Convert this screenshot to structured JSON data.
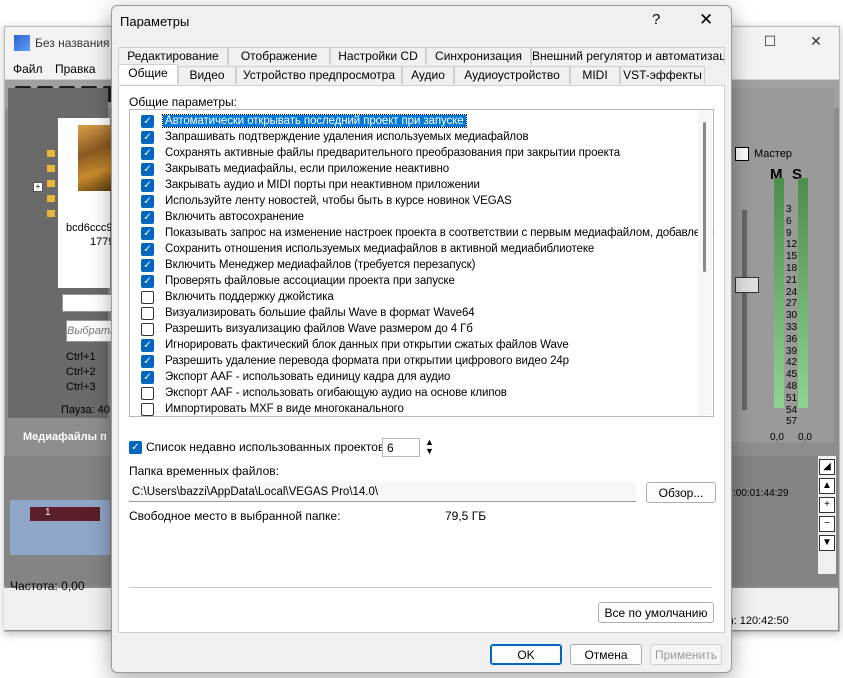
{
  "background_app": {
    "title": "Без названия",
    "menu": [
      "Файл",
      "Правка"
    ],
    "media_file": "bcd6ccc9",
    "media_file_size": "1779",
    "search_placeholder": "Выбрать",
    "shortcuts": [
      "Ctrl+1",
      "Ctrl+2",
      "Ctrl+3"
    ],
    "pause_label": "Пауза: 40",
    "media_panel_label": "Медиафайлы п",
    "master_label": "Мастер",
    "meter_marks": [
      "3",
      "6",
      "9",
      "12",
      "15",
      "18",
      "21",
      "24",
      "27",
      "30",
      "33",
      "36",
      "39",
      "42",
      "45",
      "48",
      "51",
      "54",
      "57"
    ],
    "meter_values": [
      "0,0",
      "0,0"
    ],
    "track_number": "1",
    "timecode": ":00:01:44:29",
    "frequency": "Частота: 0,00",
    "time_total": "): 120:42:50",
    "mixer_m": "M",
    "mixer_s": "S"
  },
  "dialog": {
    "title": "Параметры",
    "help": "?",
    "close": "✕",
    "tabs_row1": [
      "Редактирование",
      "Отображение",
      "Настройки CD",
      "Синхронизация",
      "Внешний регулятор и автоматизац"
    ],
    "tabs_row2": [
      "Общие",
      "Видео",
      "Устройство предпросмотра",
      "Аудио",
      "Аудиоустройство",
      "MIDI",
      "VST-эффекты"
    ],
    "active_tab": "Общие",
    "section_label": "Общие параметры:",
    "options": [
      {
        "label": "Автоматически открывать последний проект при запуске",
        "checked": true,
        "selected": true
      },
      {
        "label": "Запрашивать подтверждение удаления используемых медиафайлов",
        "checked": true
      },
      {
        "label": "Сохранять активные файлы предварительного преобразования при закрытии проекта",
        "checked": true
      },
      {
        "label": "Закрывать медиафайлы, если приложение неактивно",
        "checked": true
      },
      {
        "label": "Закрывать аудио и MIDI порты при неактивном приложении",
        "checked": true
      },
      {
        "label": "Используйте ленту новостей, чтобы быть в курсе новинок VEGAS",
        "checked": true
      },
      {
        "label": "Включить автосохранение",
        "checked": true
      },
      {
        "label": "Показывать запрос на изменение настроек проекта в соответствии с первым медиафайлом, добавленн",
        "checked": true
      },
      {
        "label": "Сохранить отношения используемых медиафайлов в активной медиабиблиотеке",
        "checked": true
      },
      {
        "label": "Включить Менеджер медиафайлов (требуется перезапуск)",
        "checked": true
      },
      {
        "label": "Проверять файловые ассоциации проекта при запуске",
        "checked": true
      },
      {
        "label": "Включить поддержку джойстика",
        "checked": false
      },
      {
        "label": "Визуализировать большие файлы Wave в формат Wave64",
        "checked": false
      },
      {
        "label": "Разрешить визуализацию файлов Wave размером до 4 Гб",
        "checked": false
      },
      {
        "label": "Игнорировать фактический блок данных при открытии сжатых файлов Wave",
        "checked": true
      },
      {
        "label": "Разрешить удаление перевода формата при открытии цифрового видео 24p",
        "checked": true
      },
      {
        "label": "Экспорт AAF - использовать единицу кадра для аудио",
        "checked": true
      },
      {
        "label": "Экспорт AAF - использовать огибающую аудио на основе клипов",
        "checked": false
      },
      {
        "label": "Импортировать MXF в виде многоканального",
        "checked": false
      }
    ],
    "recent_projects_label": "Список недавно использованных проектов:",
    "recent_projects_checked": true,
    "recent_projects_count": "6",
    "temp_folder_label": "Папка временных файлов:",
    "temp_folder_path": "C:\\Users\\bazzi\\AppData\\Local\\VEGAS Pro\\14.0\\",
    "browse_button": "Обзор...",
    "free_space_label": "Свободное место в выбранной папке:",
    "free_space_value": "79,5 ГБ",
    "defaults_button": "Все по умолчанию",
    "ok_button": "OK",
    "cancel_button": "Отмена",
    "apply_button": "Применить"
  }
}
